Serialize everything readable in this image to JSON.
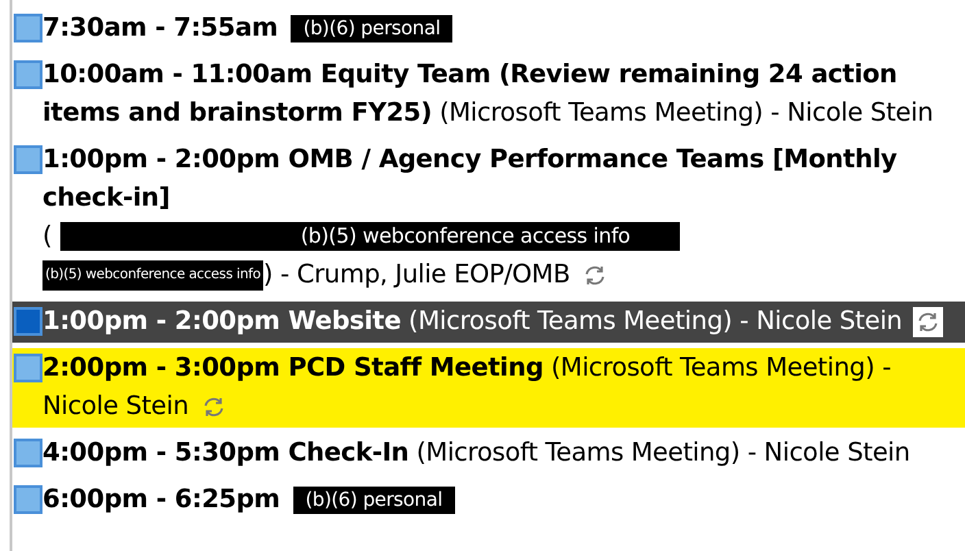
{
  "events": [
    {
      "color": "#7ab6ea",
      "kind": "plain",
      "recurring": false,
      "segments": [
        {
          "kind": "bold",
          "text": "7:30am - 7:55am"
        },
        {
          "kind": "redaction",
          "text": "(b)(6) personal"
        }
      ]
    },
    {
      "color": "#7ab6ea",
      "kind": "plain",
      "recurring": false,
      "segments": [
        {
          "kind": "bold",
          "text": "10:00am - 11:00am Equity Team (Review remaining 24 action"
        },
        {
          "kind": "bold",
          "text": "items and brainstorm FY25)"
        },
        {
          "kind": "text",
          "text": "(Microsoft Teams Meeting) - Nicole Stein"
        }
      ]
    },
    {
      "color": "#7ab6ea",
      "kind": "plain",
      "recurring": true,
      "segments": [
        {
          "kind": "bold",
          "text": "1:00pm - 2:00pm OMB / Agency Performance Teams [Monthly"
        },
        {
          "kind": "bold_line",
          "text": "check-in]"
        },
        {
          "kind": "text",
          "text": "("
        },
        {
          "kind": "wide_redaction",
          "text": "(b)(5) webconference access info"
        },
        {
          "kind": "small_redaction",
          "text": "(b)(5) webconference access info"
        },
        {
          "kind": "text",
          "text": ") - Crump, Julie  EOP/OMB"
        }
      ]
    },
    {
      "color": "#0a5fbf",
      "kind": "dark",
      "recurring": true,
      "segments": [
        {
          "kind": "bold",
          "text": "1:00pm - 2:00pm Website"
        },
        {
          "kind": "text",
          "text": "(Microsoft Teams Meeting) - Nicole Stein"
        }
      ]
    },
    {
      "color": "#7ab6ea",
      "kind": "yellow",
      "recurring": true,
      "segments": [
        {
          "kind": "bold",
          "text": "2:00pm - 3:00pm PCD Staff Meeting"
        },
        {
          "kind": "text",
          "text": "(Microsoft Teams Meeting) -"
        },
        {
          "kind": "text",
          "text": "Nicole Stein"
        }
      ]
    },
    {
      "color": "#7ab6ea",
      "kind": "plain",
      "recurring": false,
      "segments": [
        {
          "kind": "bold",
          "text": "4:00pm - 5:30pm Check-In"
        },
        {
          "kind": "text",
          "text": "(Microsoft Teams Meeting) - Nicole Stein"
        }
      ]
    },
    {
      "color": "#7ab6ea",
      "kind": "plain",
      "recurring": false,
      "segments": [
        {
          "kind": "bold",
          "text": "6:00pm - 6:25pm"
        },
        {
          "kind": "redaction",
          "text": "(b)(6) personal"
        }
      ]
    }
  ]
}
